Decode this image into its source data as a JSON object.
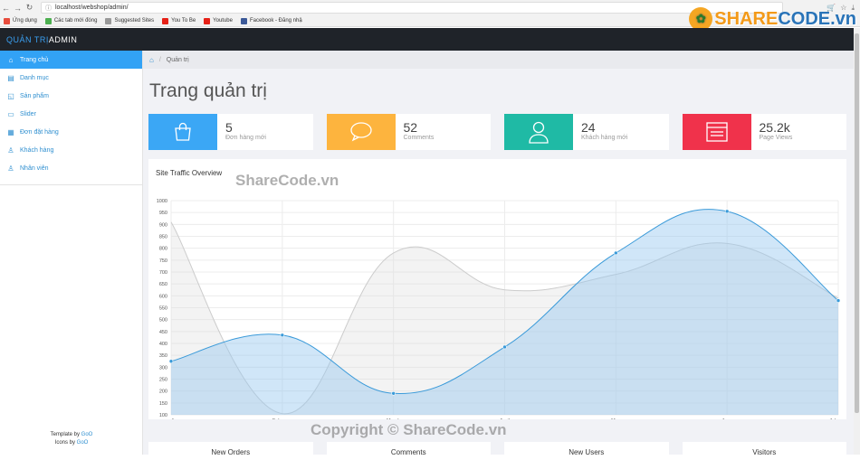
{
  "browser": {
    "address": "localhost/webshop/admin/",
    "bookmarks": [
      {
        "label": "Ứng dụng",
        "color": "#e74c3c"
      },
      {
        "label": "Các tab mới đóng",
        "color": "#4caf50"
      },
      {
        "label": "Suggested Sites",
        "color": "#999999"
      },
      {
        "label": "You To Be",
        "color": "#e62117"
      },
      {
        "label": "Youtube",
        "color": "#e62117"
      },
      {
        "label": "Facebook - Đăng nhậ",
        "color": "#3b5998"
      }
    ]
  },
  "logo": {
    "part1": "SHARE",
    "part2": "CODE.vn"
  },
  "header": {
    "brand_a": "QUẢN TRỊ",
    "brand_b": "ADMIN"
  },
  "sidebar": {
    "items": [
      {
        "label": "Trang chủ",
        "icon": "home-icon",
        "glyph": "⌂",
        "active": true
      },
      {
        "label": "Danh mục",
        "icon": "list-icon",
        "glyph": "▤",
        "active": false
      },
      {
        "label": "Sản phẩm",
        "icon": "bag-icon",
        "glyph": "◱",
        "active": false
      },
      {
        "label": "Slider",
        "icon": "image-icon",
        "glyph": "▭",
        "active": false
      },
      {
        "label": "Đơn đặt hàng",
        "icon": "calendar-icon",
        "glyph": "▦",
        "active": false
      },
      {
        "label": "Khách hàng",
        "icon": "user-icon",
        "glyph": "♙",
        "active": false
      },
      {
        "label": "Nhân viên",
        "icon": "user-icon",
        "glyph": "♙",
        "active": false
      }
    ],
    "footer_template_prefix": "Template by ",
    "footer_template_link": "GoO",
    "footer_icons_prefix": "Icons by ",
    "footer_icons_link": "GoO"
  },
  "breadcrumb": {
    "current": "Quản trị"
  },
  "page": {
    "title": "Trang quản trị"
  },
  "cards": [
    {
      "value": "5",
      "label": "Đơn hàng mới",
      "color": "#3ba7f5",
      "icon": "shopping-bag-icon"
    },
    {
      "value": "52",
      "label": "Comments",
      "color": "#fdb43e",
      "icon": "comment-icon"
    },
    {
      "value": "24",
      "label": "Khách hàng mới",
      "color": "#1fbaa5",
      "icon": "user-icon"
    },
    {
      "value": "25.2k",
      "label": "Page Views",
      "color": "#f0324b",
      "icon": "browser-icon"
    }
  ],
  "chart_panel": {
    "title": "Site Traffic Overview"
  },
  "chart_data": {
    "type": "area",
    "title": "Site Traffic Overview",
    "categories": [
      "January",
      "February",
      "March",
      "April",
      "May",
      "June",
      "July"
    ],
    "ylim": [
      100,
      1000
    ],
    "yticks": [
      100,
      150,
      200,
      250,
      300,
      350,
      400,
      450,
      500,
      550,
      600,
      650,
      700,
      750,
      800,
      850,
      900,
      950,
      1000
    ],
    "grid": true,
    "series": [
      {
        "values": [
          910,
          105,
          780,
          625,
          690,
          820,
          590
        ],
        "color": "#cccccc",
        "fill": "rgba(220,220,220,0.35)",
        "points": false
      },
      {
        "values": [
          325,
          435,
          190,
          385,
          780,
          955,
          580
        ],
        "color": "#3a9ad9",
        "fill": "rgba(151,200,240,0.45)",
        "points": true
      }
    ]
  },
  "bottom_tabs": [
    "New Orders",
    "Comments",
    "New Users",
    "Visitors"
  ],
  "watermarks": {
    "top": "ShareCode.vn",
    "bottom": "Copyright © ShareCode.vn"
  }
}
